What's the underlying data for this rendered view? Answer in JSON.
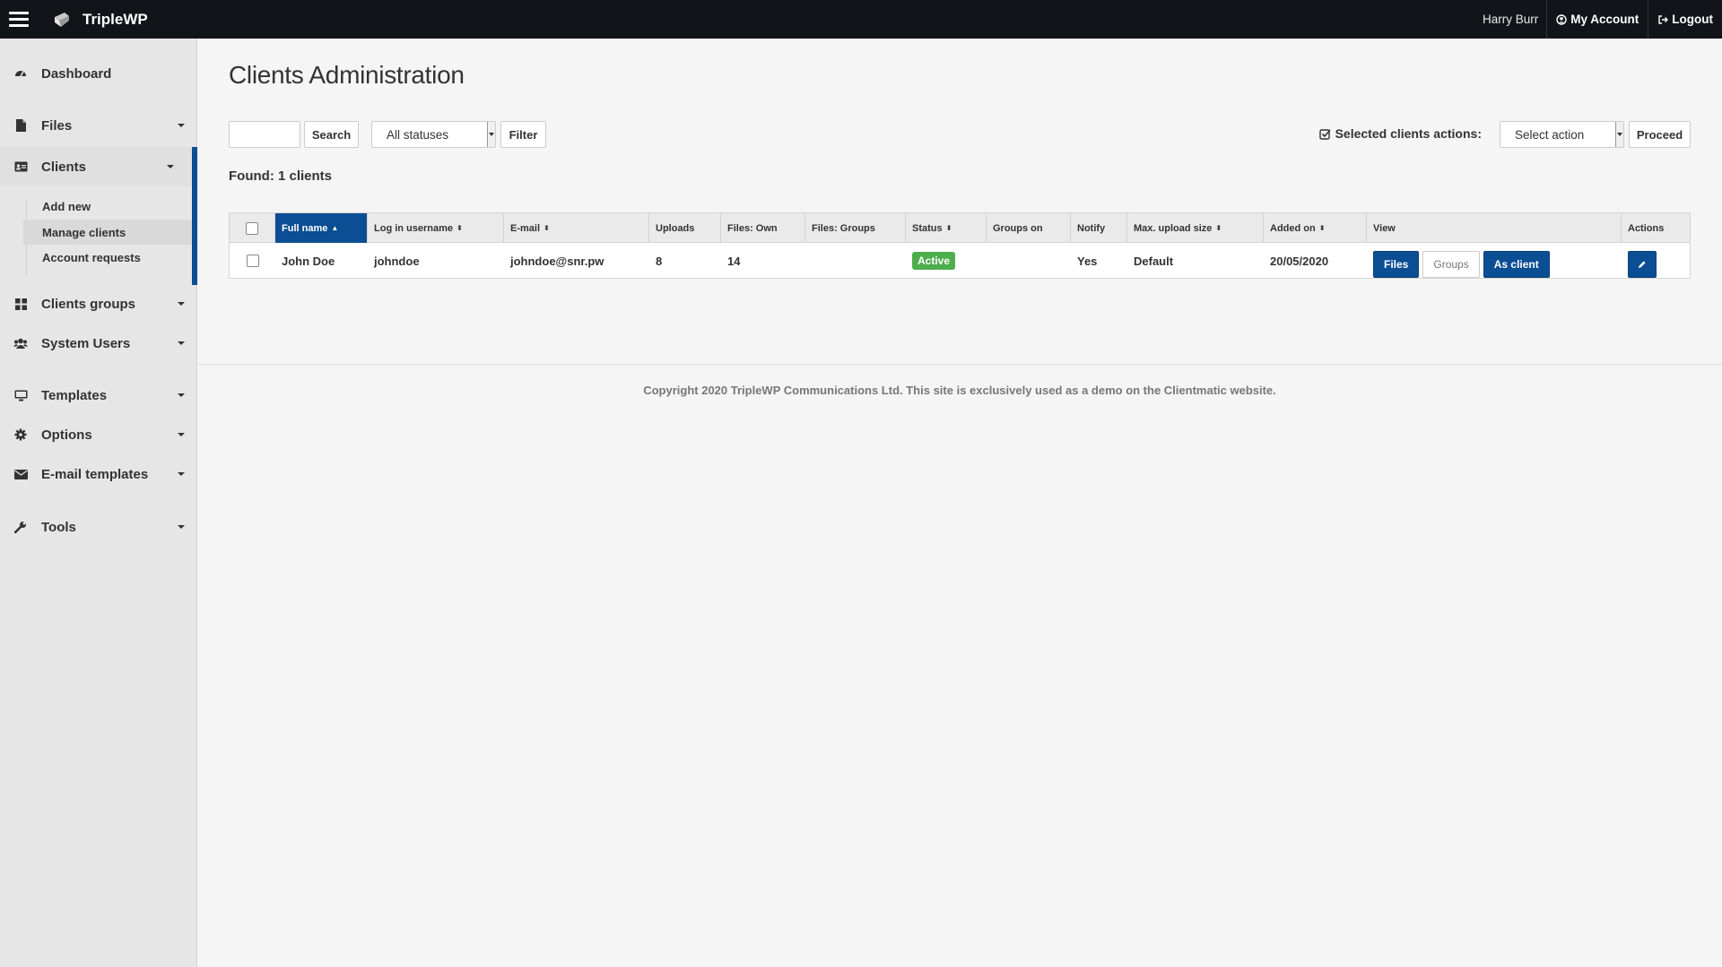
{
  "topbar": {
    "brand": "TripleWP",
    "user_name": "Harry Burr",
    "my_account": "My Account",
    "logout": "Logout"
  },
  "sidebar": {
    "items": [
      {
        "label": "Dashboard",
        "icon": "dashboard-icon"
      },
      {
        "label": "Files",
        "icon": "file-icon"
      },
      {
        "label": "Clients",
        "icon": "id-card-icon"
      },
      {
        "label": "Clients groups",
        "icon": "grid-icon"
      },
      {
        "label": "System Users",
        "icon": "users-icon"
      },
      {
        "label": "Templates",
        "icon": "monitor-icon"
      },
      {
        "label": "Options",
        "icon": "gear-icon"
      },
      {
        "label": "E-mail templates",
        "icon": "envelope-icon"
      },
      {
        "label": "Tools",
        "icon": "wrench-icon"
      }
    ],
    "clients_sub": [
      "Add new",
      "Manage clients",
      "Account requests"
    ]
  },
  "main": {
    "title": "Clients Administration",
    "search_button": "Search",
    "status_select": "All statuses",
    "filter_button": "Filter",
    "bulk_label": "Selected clients actions:",
    "action_select": "Select action",
    "proceed_button": "Proceed",
    "found": "Found: 1 clients"
  },
  "table": {
    "columns": [
      "Full name",
      "Log in username",
      "E-mail",
      "Uploads",
      "Files: Own",
      "Files: Groups",
      "Status",
      "Groups on",
      "Notify",
      "Max. upload size",
      "Added on",
      "View",
      "Actions"
    ],
    "rows": [
      {
        "full_name": "John Doe",
        "username": "johndoe",
        "email": "johndoe@snr.pw",
        "uploads": "8",
        "files_own": "14",
        "files_groups": "",
        "status": "Active",
        "groups_on": "",
        "notify": "Yes",
        "max_upload": "Default",
        "added_on": "20/05/2020",
        "view_files": "Files",
        "view_groups": "Groups",
        "view_as_client": "As client"
      }
    ]
  },
  "footer": "Copyright 2020 TripleWP Communications Ltd. This site is exclusively used as a demo on the Clientmatic website.",
  "colors": {
    "topbar": "#111418",
    "accent": "#0c4e93",
    "active_badge": "#4cae4c",
    "sidebar": "#e6e6e6"
  }
}
